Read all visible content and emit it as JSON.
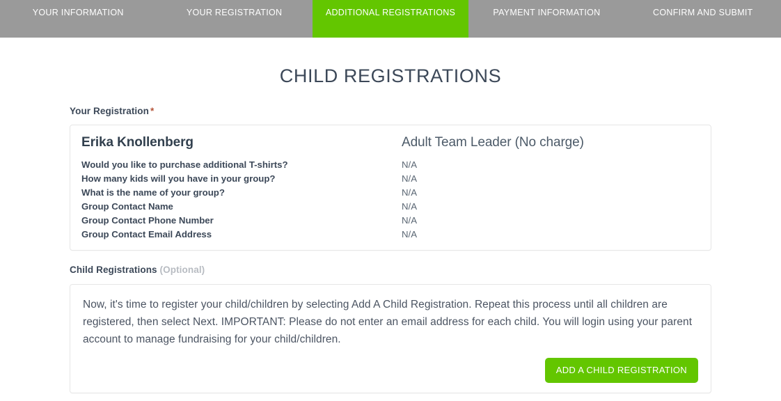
{
  "steps": [
    {
      "label": "YOUR INFORMATION",
      "active": false
    },
    {
      "label": "YOUR REGISTRATION",
      "active": false
    },
    {
      "label": "ADDITIONAL REGISTRATIONS",
      "active": true
    },
    {
      "label": "PAYMENT INFORMATION",
      "active": false
    },
    {
      "label": "CONFIRM AND SUBMIT",
      "active": false
    }
  ],
  "page": {
    "title": "CHILD REGISTRATIONS"
  },
  "your_registration": {
    "label": "Your Registration",
    "required_marker": "*",
    "registrant_name": "Erika Knollenberg",
    "registration_type": "Adult Team Leader (No charge)",
    "questions": [
      {
        "question": "Would you like to purchase additional T-shirts?",
        "answer": "N/A"
      },
      {
        "question": "How many kids will you have in your group?",
        "answer": "N/A"
      },
      {
        "question": "What is the name of your group?",
        "answer": "N/A"
      },
      {
        "question": "Group Contact Name",
        "answer": "N/A"
      },
      {
        "question": "Group Contact Phone Number",
        "answer": "N/A"
      },
      {
        "question": "Group Contact Email Address",
        "answer": "N/A"
      }
    ]
  },
  "child_registrations": {
    "label": "Child Registrations",
    "optional_note": "(Optional)",
    "instructions": "Now, it's time to register your child/children by selecting Add A Child Registration. Repeat this process until all children are registered, then select Next. IMPORTANT: Please do not enter an email address for each child. You will login using your parent account to manage fundraising for your child/children.",
    "add_button_label": "ADD A CHILD REGISTRATION"
  },
  "colors": {
    "accent_green": "#63c600",
    "stepbar_gray": "#9a9a9a",
    "required_star": "#b5553a",
    "text_dark": "#3c4858",
    "optional_gray": "#b8bcc2"
  }
}
